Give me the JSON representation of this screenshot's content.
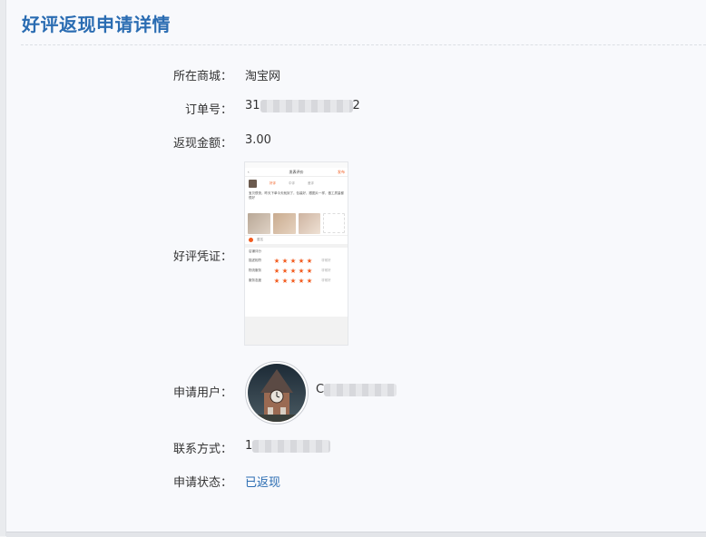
{
  "page": {
    "title": "好评返现申请详情"
  },
  "fields": {
    "mall_label": "所在商城：",
    "mall_value": "淘宝网",
    "order_label": "订单号：",
    "order_prefix": "31",
    "order_suffix": "2",
    "amount_label": "返现金额：",
    "amount_value": "3.00",
    "evidence_label": "好评凭证：",
    "user_label": "申请用户：",
    "user_prefix": "C",
    "contact_label": "联系方式：",
    "contact_prefix": "1",
    "status_label": "申请状态：",
    "status_value": "已返现"
  },
  "evidence_screenshot": {
    "header_title": "发表评价",
    "publish_label": "发布",
    "tabs": [
      "好评",
      "中评",
      "差评"
    ],
    "review_text": "宝贝很快，昨天下单今天就到了，包装好，跟图片一样，做工质量都很好",
    "anonymous_label": "匿名",
    "shop_rating_label": "店铺评分",
    "ratings": [
      {
        "label": "描述相符",
        "stars": 5,
        "note": "非常好"
      },
      {
        "label": "物流服务",
        "stars": 5,
        "note": "非常好"
      },
      {
        "label": "服务态度",
        "stars": 5,
        "note": "非常好"
      }
    ]
  },
  "colors": {
    "title": "#2a6cb2",
    "status": "#2a6cb2",
    "star": "#f25b1e"
  }
}
